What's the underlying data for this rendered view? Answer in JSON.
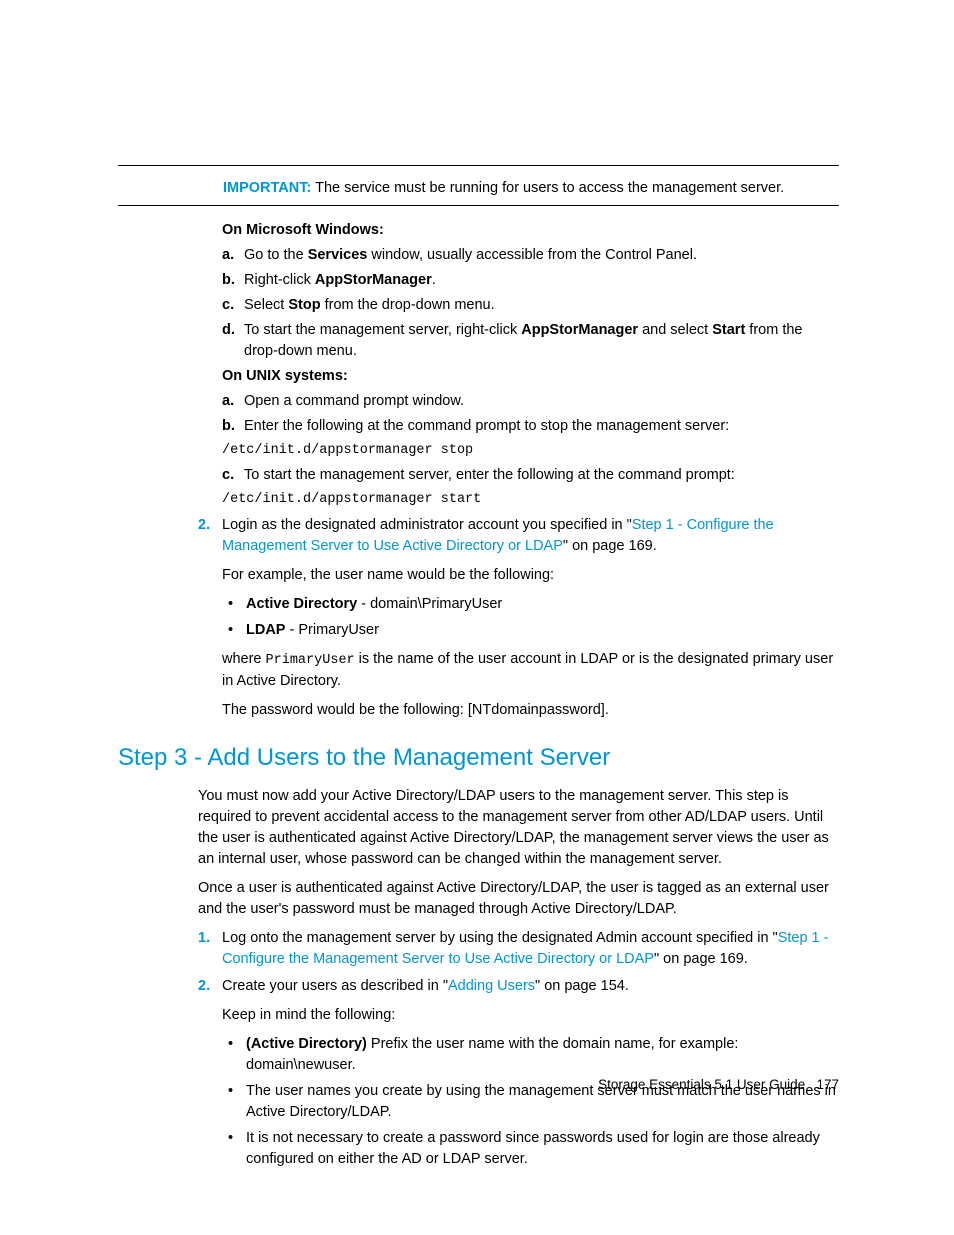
{
  "admon": {
    "label": "IMPORTANT:",
    "text": "The service must be running for users to access the management server."
  },
  "windows": {
    "heading": "On Microsoft Windows:",
    "items": {
      "a": {
        "marker": "a.",
        "pre": "Go to the ",
        "bold": "Services",
        "post": " window, usually accessible from the Control Panel."
      },
      "b": {
        "marker": "b.",
        "pre": "Right-click ",
        "bold": "AppStorManager",
        "post": "."
      },
      "c": {
        "marker": "c.",
        "pre": "Select ",
        "bold": "Stop",
        "post": " from the drop-down menu."
      },
      "d": {
        "marker": "d.",
        "pre": "To start the management server, right-click ",
        "bold1": "AppStorManager",
        "mid": " and select ",
        "bold2": "Start",
        "post": " from the drop-down menu."
      }
    }
  },
  "unix": {
    "heading": "On UNIX systems:",
    "items": {
      "a": {
        "marker": "a.",
        "text": "Open a command prompt window."
      },
      "b": {
        "marker": "b.",
        "text": "Enter the following at the command prompt to stop the management server:"
      },
      "code1": "/etc/init.d/appstormanager stop",
      "c": {
        "marker": "c.",
        "text": "To start the management server, enter the following at the command prompt:"
      },
      "code2": "/etc/init.d/appstormanager start"
    }
  },
  "ol2": {
    "marker": "2.",
    "pre": "Login as the designated administrator account you specified in \"",
    "link": "Step 1 - Configure the Management Server to Use Active Directory or LDAP",
    "post": "\" on page 169.",
    "example_intro": "For example, the user name would be the following:",
    "bullets": {
      "ad": {
        "bold": "Active Directory",
        "rest": " - domain\\PrimaryUser"
      },
      "ldap": {
        "bold": "LDAP",
        "rest": " - PrimaryUser"
      }
    },
    "where_pre": "where ",
    "where_code": "PrimaryUser",
    "where_post": " is the name of the user account in LDAP or is the designated primary user in Active Directory.",
    "password": "The password would be the following: [NTdomainpassword]."
  },
  "step3": {
    "heading": "Step 3 - Add Users to the Management Server",
    "p1": "You must now add your Active Directory/LDAP users to the management server. This step is required to prevent accidental access to the management server from other AD/LDAP users. Until the user is authenticated against Active Directory/LDAP, the management server views the user as an internal user, whose password can be changed within the management server.",
    "p2": "Once a user is authenticated against Active Directory/LDAP, the user is tagged as an external user and the user's password must be managed through Active Directory/LDAP.",
    "items": {
      "i1": {
        "marker": "1.",
        "pre": "Log onto the management server by using the designated Admin account specified in \"",
        "link": "Step 1 - Configure the Management Server to Use Active Directory or LDAP",
        "post": "\" on page 169."
      },
      "i2": {
        "marker": "2.",
        "pre": "Create your users as described in \"",
        "link": "Adding Users",
        "post": "\" on page 154.",
        "keep": "Keep in mind the following:",
        "bullets": {
          "b1": {
            "bold": "(Active Directory)",
            "rest": " Prefix the user name with the domain name, for example: domain\\newuser."
          },
          "b2": "The user names you create by using the management server must match the user names in Active Directory/LDAP.",
          "b3": "It is not necessary to create a password since passwords used for login are those already configured on either the AD or LDAP server."
        }
      }
    }
  },
  "footer": {
    "title": "Storage Essentials 5.1 User Guide",
    "page": "177"
  }
}
